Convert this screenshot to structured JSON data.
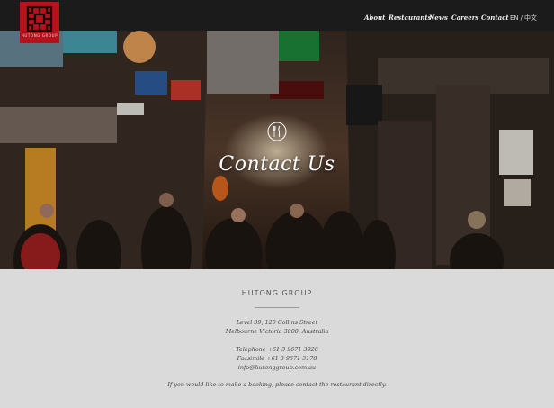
{
  "header": {
    "logo_text": "HUTONG GROUP",
    "nav": [
      {
        "label": "About"
      },
      {
        "label": "Restaurants"
      },
      {
        "label": "News"
      },
      {
        "label": "Careers"
      },
      {
        "label": "Contact"
      }
    ],
    "lang": {
      "en": "EN",
      "separator": "/",
      "zh": "中文"
    }
  },
  "hero": {
    "title": "Contact Us",
    "icon": "cutlery-icon"
  },
  "contact": {
    "company": "HUTONG GROUP",
    "address_line1": "Level 39, 120 Collins Street",
    "address_line2": "Melbourne Victoria 3000, Australia",
    "telephone": "Telephone +61 3 9671 3928",
    "facsimile": "Facsimile +61 3 9671 3178",
    "email": "info@hutonggroup.com.au",
    "booking_note": "If you would like to make a booking, please contact the restaurant directly."
  },
  "colors": {
    "header_bg": "#1b1b1b",
    "logo_red": "#b5121b",
    "content_bg": "#dadada"
  }
}
